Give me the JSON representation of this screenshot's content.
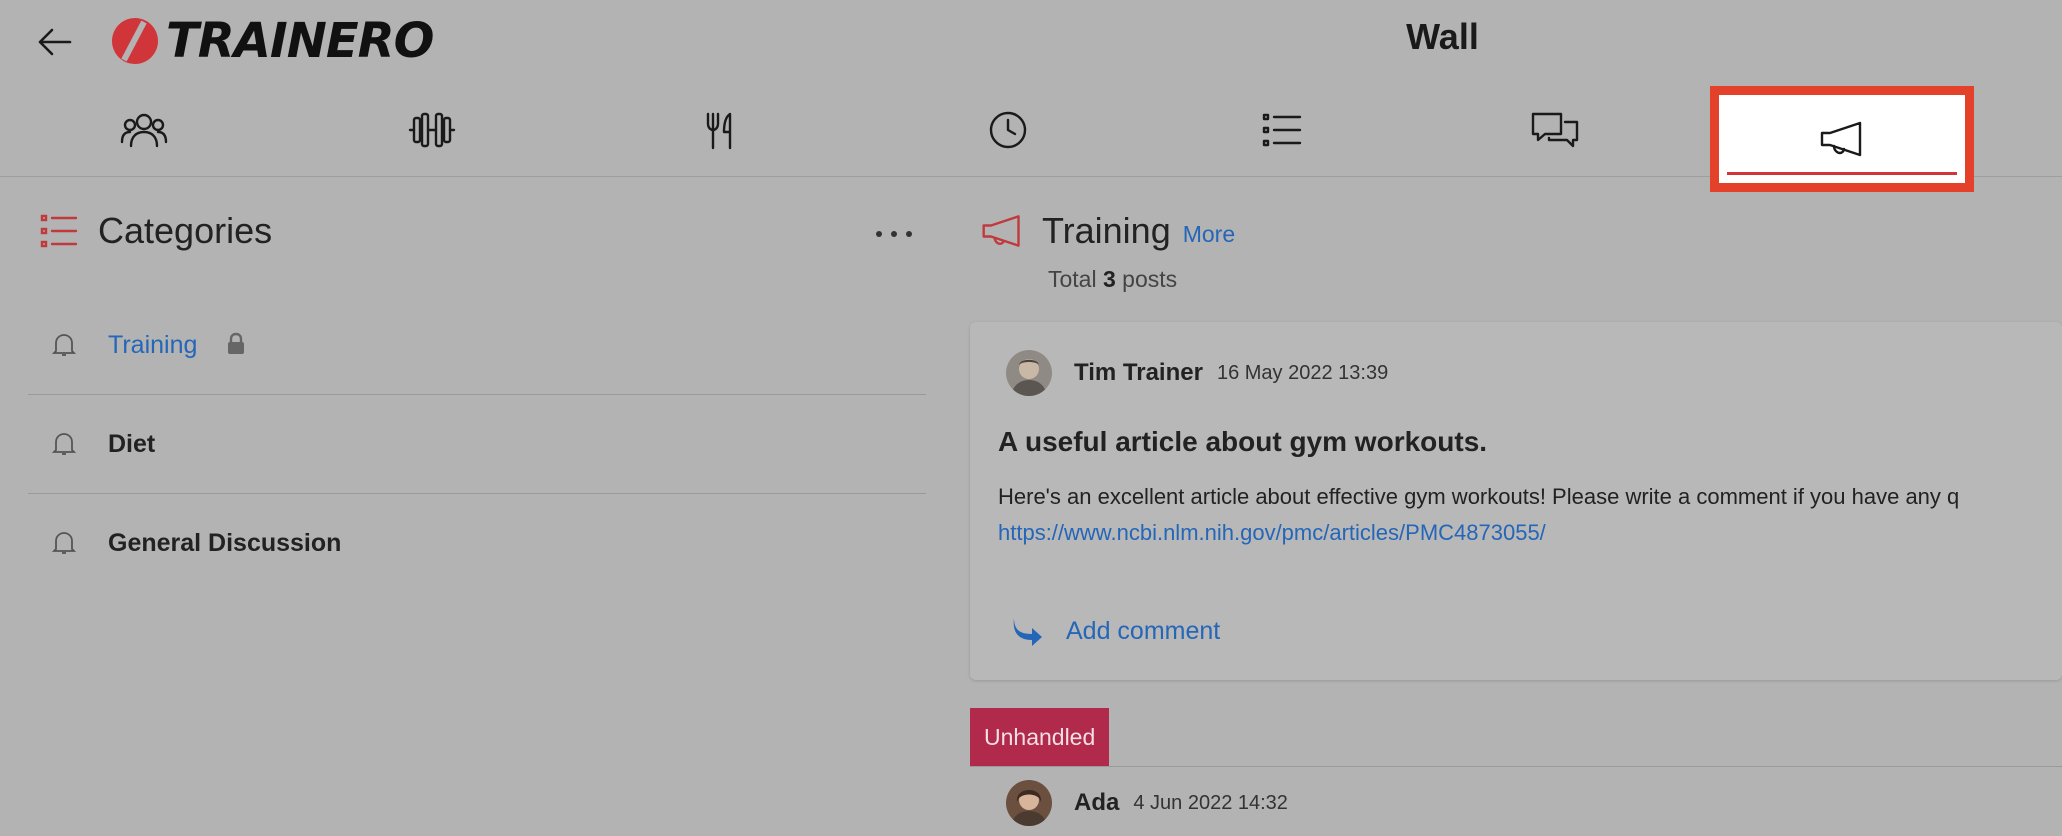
{
  "header": {
    "logo_text": "TRAINERO",
    "page_title": "Wall"
  },
  "tabs": [
    {
      "icon": "users-icon"
    },
    {
      "icon": "dumbbell-icon"
    },
    {
      "icon": "fork-knife-icon"
    },
    {
      "icon": "clock-icon"
    },
    {
      "icon": "list-icon"
    },
    {
      "icon": "chat-bubbles-icon"
    },
    {
      "icon": "megaphone-icon",
      "active": true
    }
  ],
  "categories": {
    "title": "Categories",
    "items": [
      {
        "label": "Training",
        "active": true,
        "locked": true
      },
      {
        "label": "Diet"
      },
      {
        "label": "General Discussion"
      }
    ]
  },
  "feed": {
    "title": "Training",
    "more_label": "More",
    "total_prefix": "Total",
    "total_count": "3",
    "total_suffix": "posts",
    "posts": [
      {
        "author": "Tim Trainer",
        "date": "16 May 2022 13:39",
        "title": "A useful article about gym workouts.",
        "body": "Here's an excellent article about effective gym workouts! Please write a comment if you have any q",
        "link": "https://www.ncbi.nlm.nih.gov/pmc/articles/PMC4873055/",
        "add_comment_label": "Add comment"
      },
      {
        "badge": "Unhandled",
        "author": "Ada",
        "date": "4 Jun 2022 14:32"
      }
    ]
  },
  "colors": {
    "accent_red": "#e4412b",
    "link_blue": "#2466b8",
    "badge_crimson": "#b12a4c",
    "background": "#b3b3b3"
  }
}
